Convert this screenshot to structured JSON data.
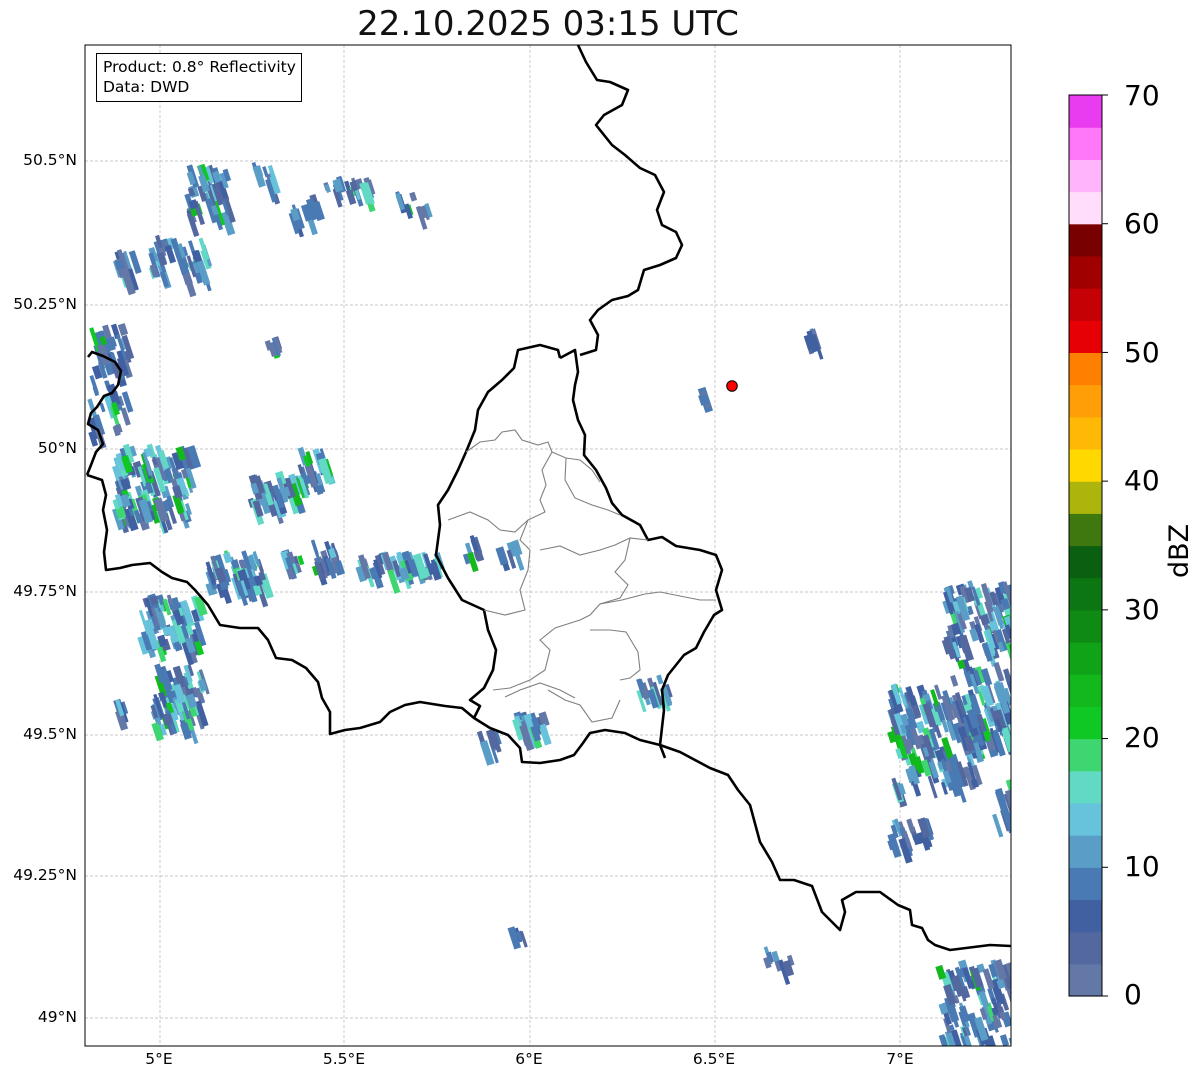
{
  "title": "22.10.2025 03:15 UTC",
  "info": {
    "product": "Product: 0.8° Reflectivity",
    "data_source": "Data: DWD"
  },
  "axes": {
    "lat_ticks": [
      "50.5°N",
      "50.25°N",
      "50°N",
      "49.75°N",
      "49.5°N",
      "49.25°N",
      "49°N"
    ],
    "lon_ticks": [
      "5°E",
      "5.5°E",
      "6°E",
      "6.5°E",
      "7°E"
    ]
  },
  "colorbar": {
    "unit": "dBZ",
    "tick_labels": [
      "0",
      "10",
      "20",
      "30",
      "40",
      "50",
      "60",
      "70"
    ],
    "range": [
      0,
      70
    ],
    "colors": [
      "#6478a8",
      "#53689f",
      "#4060a2",
      "#4a7ab3",
      "#5a9ec7",
      "#67c2db",
      "#62d9c4",
      "#3ed670",
      "#10c823",
      "#13b81d",
      "#10a318",
      "#0f8a15",
      "#0b7612",
      "#0a5f10",
      "#3f780e",
      "#adb40b",
      "#ffd800",
      "#ffb806",
      "#ff9e06",
      "#ff8000",
      "#e60005",
      "#c50106",
      "#a00000",
      "#780000",
      "#ffddfb",
      "#ffb4fc",
      "#ff78fa",
      "#e93cf0"
    ]
  },
  "radar_site_color": "#ff0000",
  "map": {
    "lon_range": [
      4.8,
      7.3
    ],
    "lat_range": [
      48.95,
      50.7
    ],
    "gridlines": true
  }
}
